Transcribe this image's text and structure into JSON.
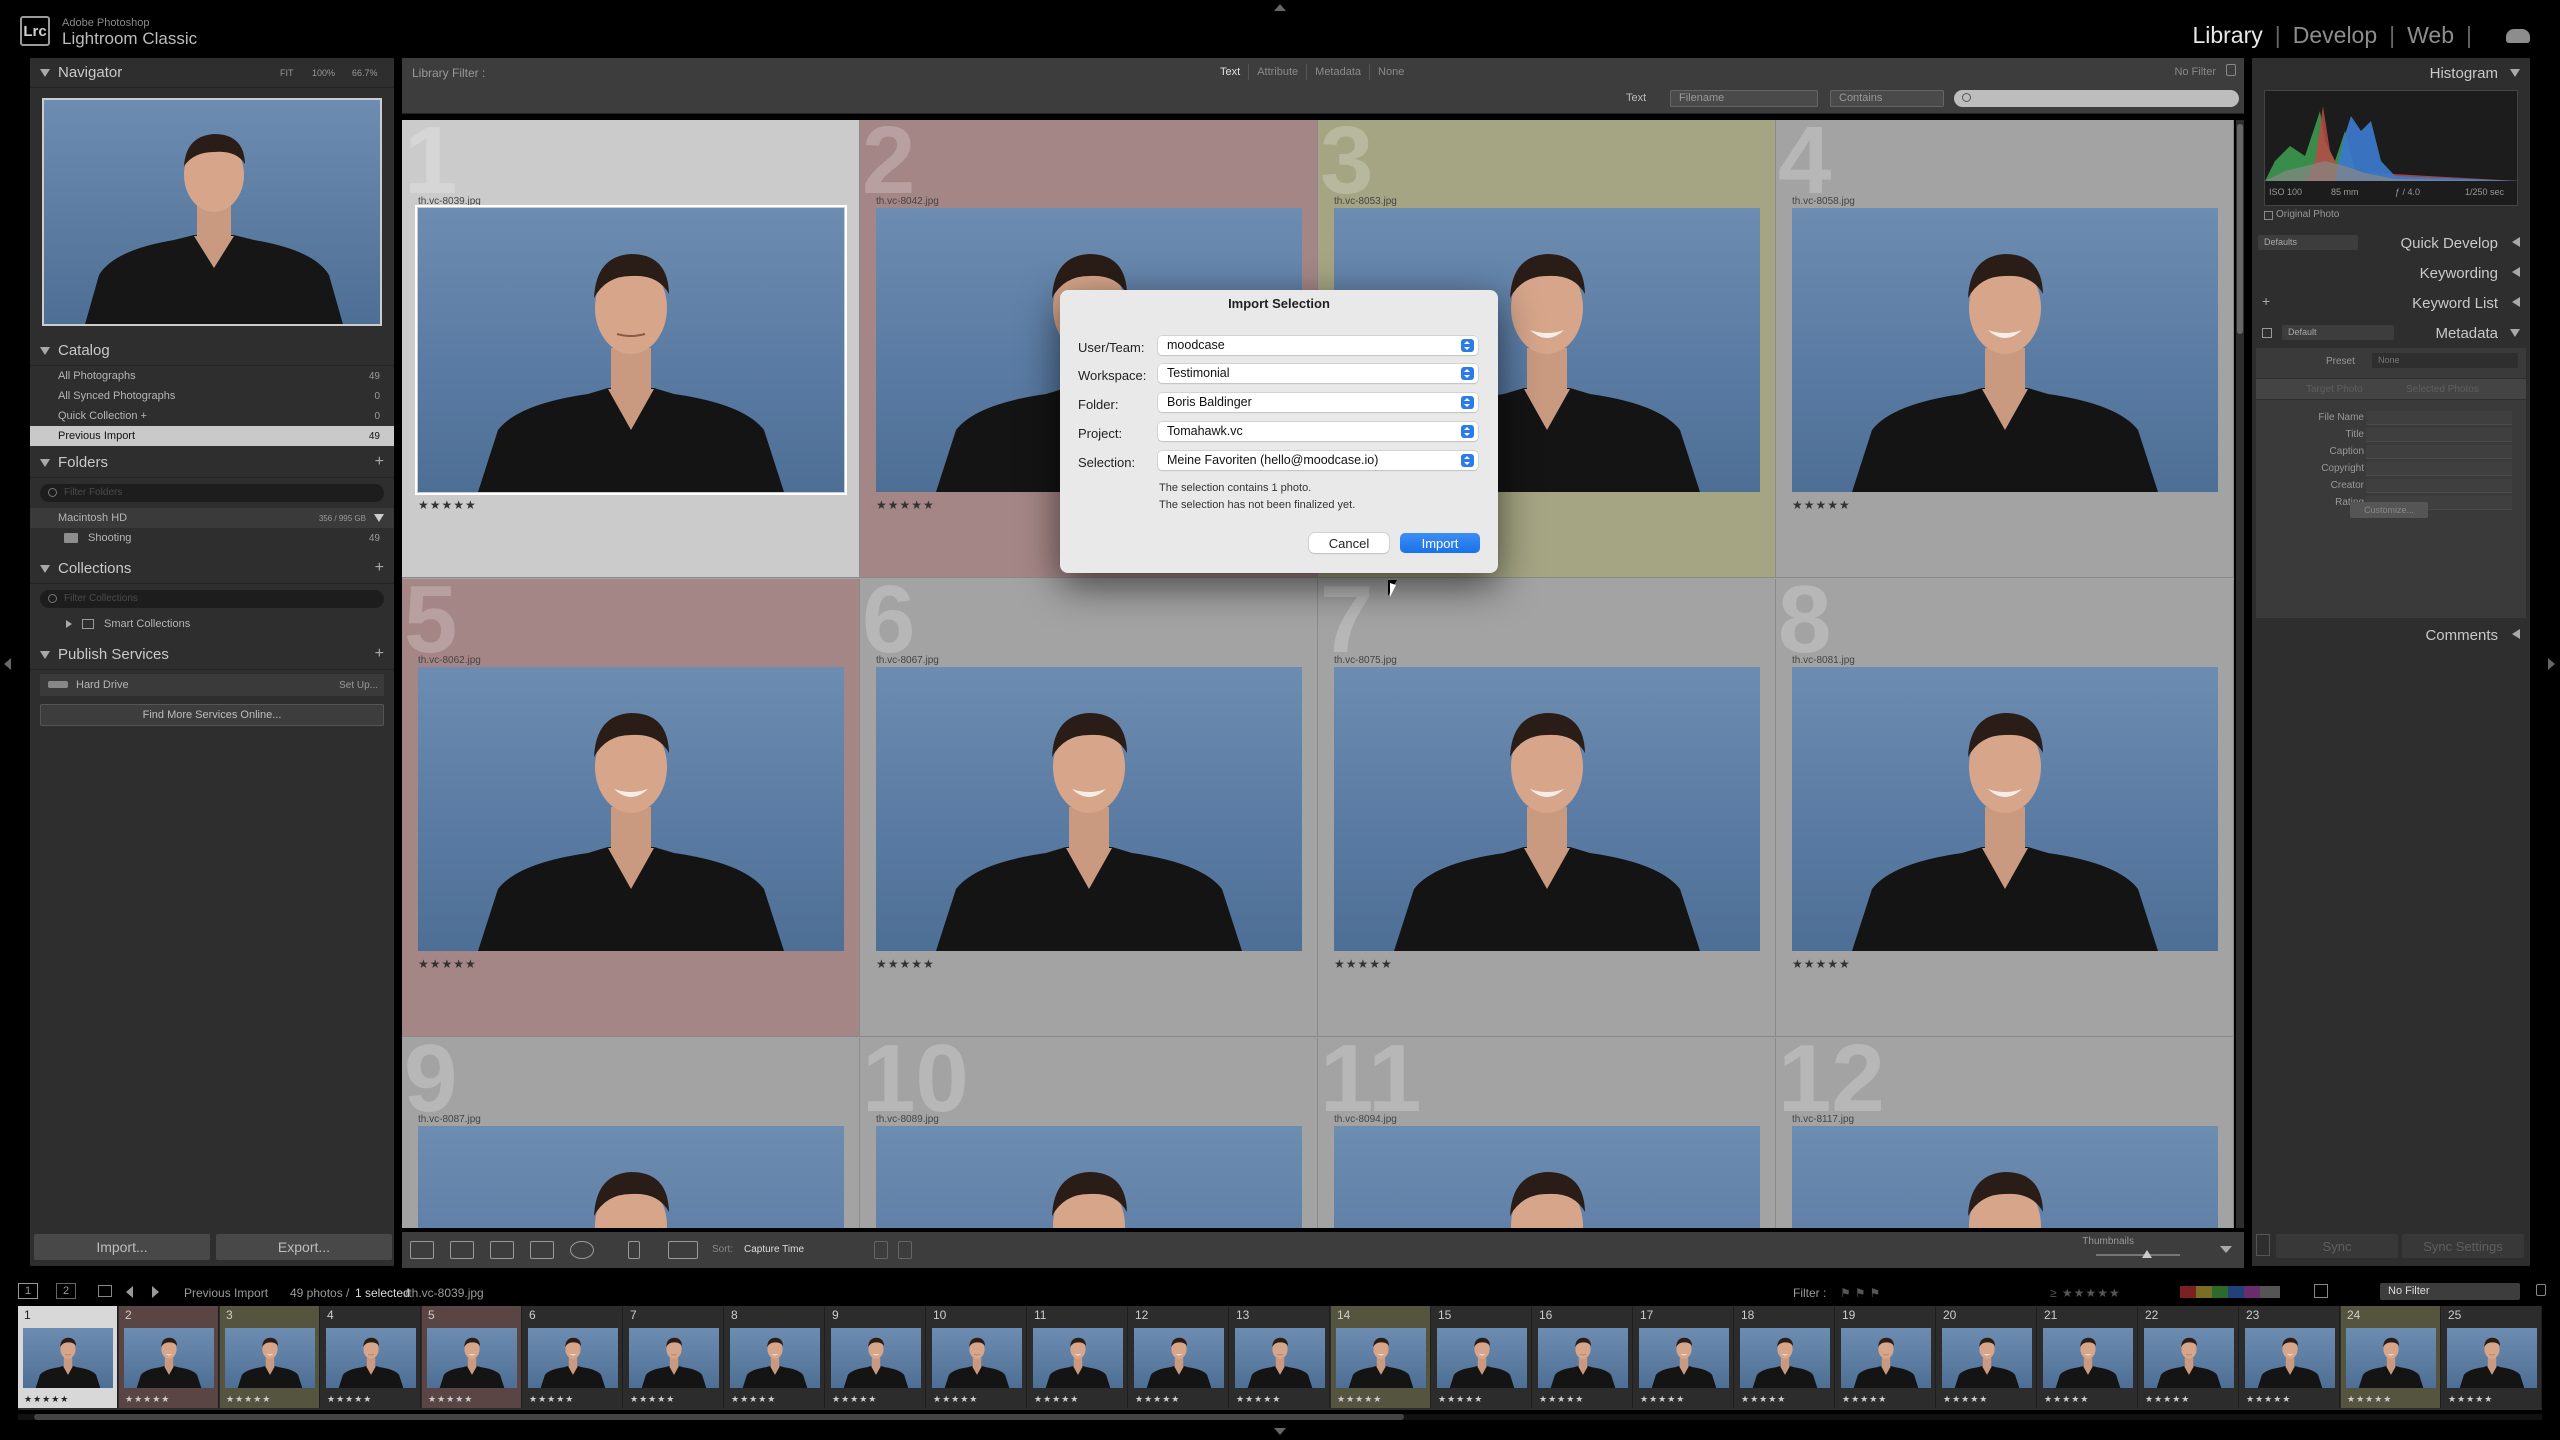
{
  "app": {
    "brand_top": "Adobe Photoshop",
    "brand_main": "Lightroom Classic",
    "logo": "Lrc"
  },
  "modules": {
    "library": "Library",
    "develop": "Develop",
    "web": "Web",
    "sep": "|"
  },
  "navigator": {
    "title": "Navigator",
    "fit": "FIT",
    "z1": "100%",
    "z2": "66.7%"
  },
  "catalog": {
    "title": "Catalog",
    "items": [
      {
        "label": "All Photographs",
        "count": "49"
      },
      {
        "label": "All Synced Photographs",
        "count": "0"
      },
      {
        "label": "Quick Collection +",
        "count": "0"
      },
      {
        "label": "Previous Import",
        "count": "49"
      }
    ]
  },
  "folders": {
    "title": "Folders",
    "filter_placeholder": "Filter Folders",
    "drive": "Macintosh HD",
    "drive_space": "356 / 995 GB",
    "folder": "Shooting",
    "folder_count": "49"
  },
  "collections": {
    "title": "Collections",
    "filter_placeholder": "Filter Collections",
    "smart": "Smart Collections"
  },
  "publish": {
    "title": "Publish Services",
    "hard_drive": "Hard Drive",
    "setup": "Set Up...",
    "find_more": "Find More Services Online..."
  },
  "left_buttons": {
    "import": "Import...",
    "export": "Export..."
  },
  "library_filter": {
    "label": "Library Filter :",
    "tabs": [
      "Text",
      "Attribute",
      "Metadata",
      "None"
    ],
    "no_filter": "No Filter",
    "text_label": "Text",
    "field": "Filename",
    "rule": "Contains"
  },
  "grid": {
    "cells": [
      {
        "num": "1",
        "file": "th.vc-8039.jpg",
        "bg": "#cbcbcb",
        "smile": false
      },
      {
        "num": "2",
        "file": "th.vc-8042.jpg",
        "bg": "#a58686",
        "smile": false
      },
      {
        "num": "3",
        "file": "th.vc-8053.jpg",
        "bg": "#a5a583",
        "smile": true
      },
      {
        "num": "4",
        "file": "th.vc-8058.jpg",
        "bg": "#a3a3a3",
        "smile": true
      },
      {
        "num": "5",
        "file": "th.vc-8062.jpg",
        "bg": "#a58686",
        "smile": true
      },
      {
        "num": "6",
        "file": "th.vc-8067.jpg",
        "bg": "#a3a3a3",
        "smile": true
      },
      {
        "num": "7",
        "file": "th.vc-8075.jpg",
        "bg": "#a3a3a3",
        "smile": true
      },
      {
        "num": "8",
        "file": "th.vc-8081.jpg",
        "bg": "#a3a3a3",
        "smile": true
      },
      {
        "num": "9",
        "file": "th.vc-8087.jpg",
        "bg": "#a3a3a3",
        "smile": false
      },
      {
        "num": "10",
        "file": "th.vc-8089.jpg",
        "bg": "#a3a3a3",
        "smile": true
      },
      {
        "num": "11",
        "file": "th.vc-8094.jpg",
        "bg": "#a3a3a3",
        "smile": true
      },
      {
        "num": "12",
        "file": "th.vc-8117.jpg",
        "bg": "#a3a3a3",
        "smile": true
      }
    ],
    "stars": "★★★★★"
  },
  "toolbar": {
    "sort_label": "Sort:",
    "sort_value": "Capture Time",
    "thumbnails": "Thumbnails"
  },
  "histogram": {
    "title": "Histogram",
    "iso": "ISO 100",
    "focal": "85 mm",
    "aperture": "ƒ / 4.0",
    "shutter": "1/250 sec",
    "original": "Original Photo"
  },
  "right_panel": {
    "defaults": "Defaults",
    "quick_develop": "Quick Develop",
    "keywording": "Keywording",
    "keyword_list": "Keyword List",
    "metadata": "Metadata",
    "metadata_preset_default": "Default",
    "preset_label": "Preset",
    "preset_value": "None",
    "target_photo": "Target Photo",
    "selected_photos": "Selected Photos",
    "fields": [
      "File Name",
      "Title",
      "Caption",
      "Copyright",
      "Creator",
      "Rating"
    ],
    "customize": "Customize...",
    "comments": "Comments",
    "sync": "Sync",
    "sync_settings": "Sync Settings"
  },
  "filmstrip": {
    "page1": "1",
    "page2": "2",
    "source": "Previous Import",
    "count_text": "49 photos /",
    "selected_text": "1 selected",
    "file_text": "/th.vc-8039.jpg",
    "filter_label": "Filter :",
    "filter_value": "No Filter",
    "stars": "★★★★★",
    "items": [
      "1",
      "2",
      "3",
      "4",
      "5",
      "6",
      "7",
      "8",
      "9",
      "10",
      "11",
      "12",
      "13",
      "14",
      "15",
      "16",
      "17",
      "18",
      "19",
      "20",
      "21",
      "22",
      "23",
      "24",
      "25"
    ],
    "colors": [
      "#3a3a3a",
      "#5a4444",
      "#55553f",
      "#2c2c2c",
      "#5a4444",
      "#2c2c2c",
      "#2c2c2c",
      "#2c2c2c",
      "#2c2c2c",
      "#2c2c2c",
      "#2c2c2c",
      "#2c2c2c",
      "#2c2c2c",
      "#55553f",
      "#2c2c2c",
      "#2c2c2c",
      "#2c2c2c",
      "#2c2c2c",
      "#2c2c2c",
      "#2c2c2c",
      "#2c2c2c",
      "#2c2c2c",
      "#2c2c2c",
      "#55553f",
      "#2c2c2c"
    ]
  },
  "dialog": {
    "title": "Import Selection",
    "rows": [
      {
        "label": "User/Team:",
        "value": "moodcase"
      },
      {
        "label": "Workspace:",
        "value": "Testimonial"
      },
      {
        "label": "Folder:",
        "value": "Boris Baldinger"
      },
      {
        "label": "Project:",
        "value": "Tomahawk.vc"
      },
      {
        "label": "Selection:",
        "value": "Meine Favoriten (hello@moodcase.io)"
      }
    ],
    "info1": "The selection contains 1 photo.",
    "info2": "The selection has not been finalized yet.",
    "cancel": "Cancel",
    "import": "Import",
    "accent": "#2b7bea"
  }
}
